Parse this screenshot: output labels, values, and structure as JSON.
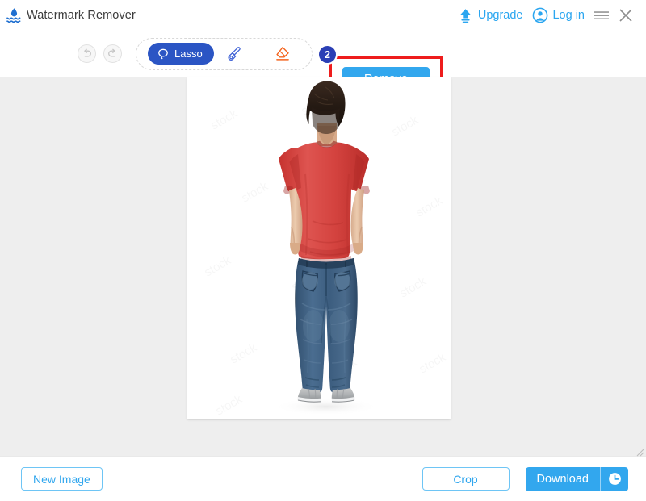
{
  "window": {
    "app_title": "Watermark Remover",
    "logo_icon": "watermark-drop-icon",
    "menu_icon": "hamburger-menu-icon",
    "close_icon": "close-icon"
  },
  "header": {
    "upgrade_label": "Upgrade",
    "upgrade_icon": "upload-arrow-icon",
    "login_label": "Log in",
    "login_icon": "user-circle-icon"
  },
  "toolbar": {
    "undo_icon": "undo-arrow-icon",
    "redo_icon": "redo-arrow-icon",
    "lasso_label": "Lasso",
    "lasso_icon": "lasso-icon",
    "brush_icon": "brush-icon",
    "eraser_icon": "eraser-icon",
    "remove_label": "Remove",
    "step_badge": "2"
  },
  "canvas": {
    "watermark_text": "stock",
    "photo_alt": "Man standing with back turned wearing red t-shirt and blue jeans on white background"
  },
  "footer": {
    "new_image_label": "New Image",
    "crop_label": "Crop",
    "download_label": "Download",
    "download_history_icon": "clock-history-icon"
  },
  "colors": {
    "accent_blue": "#32a7ee",
    "tool_blue": "#2b55c4",
    "eraser_orange": "#f4641e",
    "highlight_red": "#ee1c1c",
    "badge_blue": "#2b3fb5",
    "canvas_gray": "#eeeeee",
    "shirt_red": "#d8413d",
    "jeans_blue": "#3d5a80"
  }
}
